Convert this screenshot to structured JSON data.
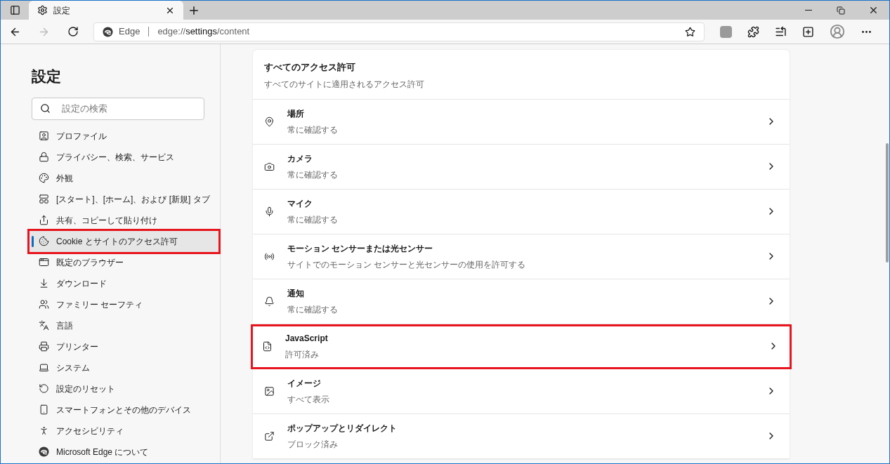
{
  "tab": {
    "title": "設定",
    "selected": true
  },
  "address_bar": {
    "site_label": "Edge",
    "url_prefix": "edge://",
    "url_bold": "settings",
    "url_suffix": "/content"
  },
  "sidebar": {
    "title": "設定",
    "search": {
      "placeholder": "設定の検索"
    },
    "items": [
      {
        "label": "プロファイル",
        "selected": false,
        "highlighted": false
      },
      {
        "label": "プライバシー、検索、サービス",
        "selected": false,
        "highlighted": false
      },
      {
        "label": "外観",
        "selected": false,
        "highlighted": false
      },
      {
        "label": "[スタート]、[ホーム]、および [新規] タブ",
        "selected": false,
        "highlighted": false
      },
      {
        "label": "共有、コピーして貼り付け",
        "selected": false,
        "highlighted": false
      },
      {
        "label": "Cookie とサイトのアクセス許可",
        "selected": true,
        "highlighted": true
      },
      {
        "label": "既定のブラウザー",
        "selected": false,
        "highlighted": false
      },
      {
        "label": "ダウンロード",
        "selected": false,
        "highlighted": false
      },
      {
        "label": "ファミリー セーフティ",
        "selected": false,
        "highlighted": false
      },
      {
        "label": "言語",
        "selected": false,
        "highlighted": false
      },
      {
        "label": "プリンター",
        "selected": false,
        "highlighted": false
      },
      {
        "label": "システム",
        "selected": false,
        "highlighted": false
      },
      {
        "label": "設定のリセット",
        "selected": false,
        "highlighted": false
      },
      {
        "label": "スマートフォンとその他のデバイス",
        "selected": false,
        "highlighted": false
      },
      {
        "label": "アクセシビリティ",
        "selected": false,
        "highlighted": false
      },
      {
        "label": "Microsoft Edge について",
        "selected": false,
        "highlighted": false
      }
    ]
  },
  "permissions": {
    "title": "すべてのアクセス許可",
    "subtitle": "すべてのサイトに適用されるアクセス許可",
    "rows": [
      {
        "name": "場所",
        "status": "常に確認する",
        "highlighted": false
      },
      {
        "name": "カメラ",
        "status": "常に確認する",
        "highlighted": false
      },
      {
        "name": "マイク",
        "status": "常に確認する",
        "highlighted": false
      },
      {
        "name": "モーション センサーまたは光センサー",
        "status": "サイトでのモーション センサーと光センサーの使用を許可する",
        "highlighted": false
      },
      {
        "name": "通知",
        "status": "常に確認する",
        "highlighted": false
      },
      {
        "name": "JavaScript",
        "status": "許可済み",
        "highlighted": true
      },
      {
        "name": "イメージ",
        "status": "すべて表示",
        "highlighted": false
      },
      {
        "name": "ポップアップとリダイレクト",
        "status": "ブロック済み",
        "highlighted": false
      }
    ]
  }
}
